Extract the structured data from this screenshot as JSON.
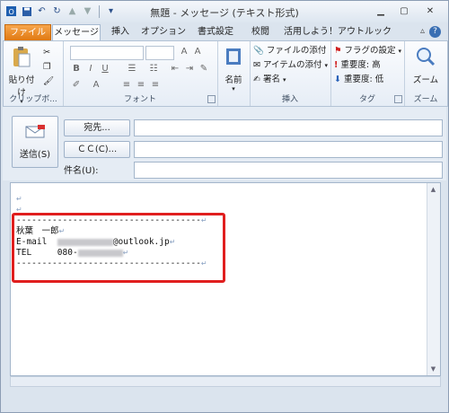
{
  "window": {
    "title": "無題 - メッセージ (テキスト形式)"
  },
  "tabs": [
    "ファイル",
    "メッセージ",
    "挿入",
    "オプション",
    "書式設定",
    "校閲",
    "活用しよう！アウトルック"
  ],
  "ribbon": {
    "clipboard": {
      "paste_label": "貼り付け",
      "group_label": "クリップボ..."
    },
    "font": {
      "group_label": "フォント"
    },
    "names": {
      "label": "名前"
    },
    "insert": {
      "attach_file": "ファイルの添付",
      "attach_item": "アイテムの添付",
      "signature": "署名",
      "group_label": "挿入"
    },
    "tags": {
      "follow_up": "フラグの設定",
      "importance_high": "重要度: 高",
      "importance_low": "重要度: 低",
      "group_label": "タグ"
    },
    "zoom": {
      "label": "ズーム",
      "group_label": "ズーム"
    }
  },
  "compose": {
    "send_label": "送信(S)",
    "to_label": "宛先...",
    "cc_label": "ＣＣ(C)...",
    "subject_label": "件名(U):"
  },
  "body": {
    "dash_line": "------------------------------------",
    "name": "秋葉　一郎",
    "email_label": "E-mail",
    "email_domain": "@outlook.jp",
    "tel_label": "TEL",
    "tel_prefix": "080-",
    "para_mark": "↵"
  },
  "colors": {
    "file_tab": "#e07912",
    "highlight_border": "#e01e1e"
  }
}
